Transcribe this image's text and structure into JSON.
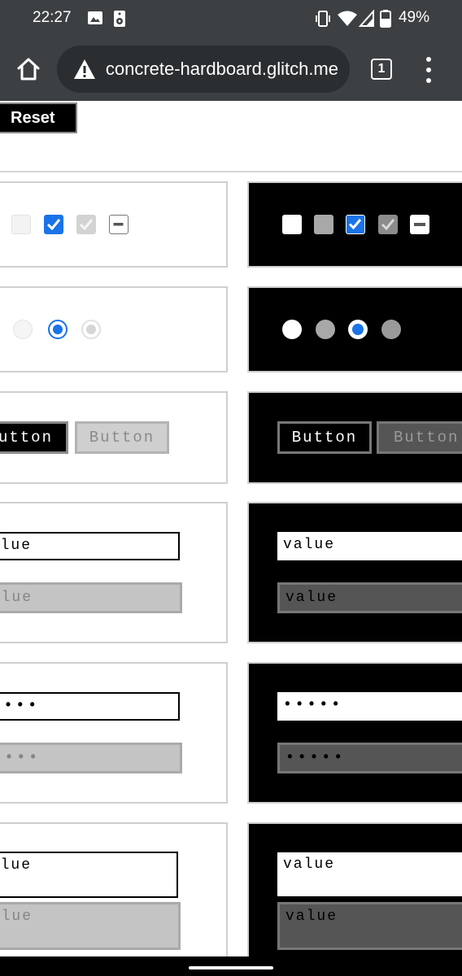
{
  "status_bar": {
    "time": "22:27",
    "battery": "49%"
  },
  "browser": {
    "url": "concrete-hardboard.glitch.me",
    "tab_count": "1"
  },
  "page": {
    "reset_label": "Reset",
    "buttons": {
      "light_primary": "Button",
      "light_disabled": "Button",
      "dark_primary": "Button",
      "dark_disabled": "Button"
    },
    "text_inputs": {
      "light_value": "value",
      "light_disabled_value": "value",
      "dark_value": "value",
      "dark_disabled_value": "value"
    },
    "password_inputs": {
      "light_value": "•••••",
      "light_disabled_value": "•••••",
      "dark_value": "•••••",
      "dark_disabled_value": "•••••"
    },
    "textareas": {
      "light_value": "value",
      "light_disabled_value": "value",
      "dark_value": "value",
      "dark_disabled_value": "value"
    }
  },
  "colors": {
    "accent": "#1a73e8",
    "chrome": "#3c4043",
    "urlbar": "#2b2e31"
  }
}
